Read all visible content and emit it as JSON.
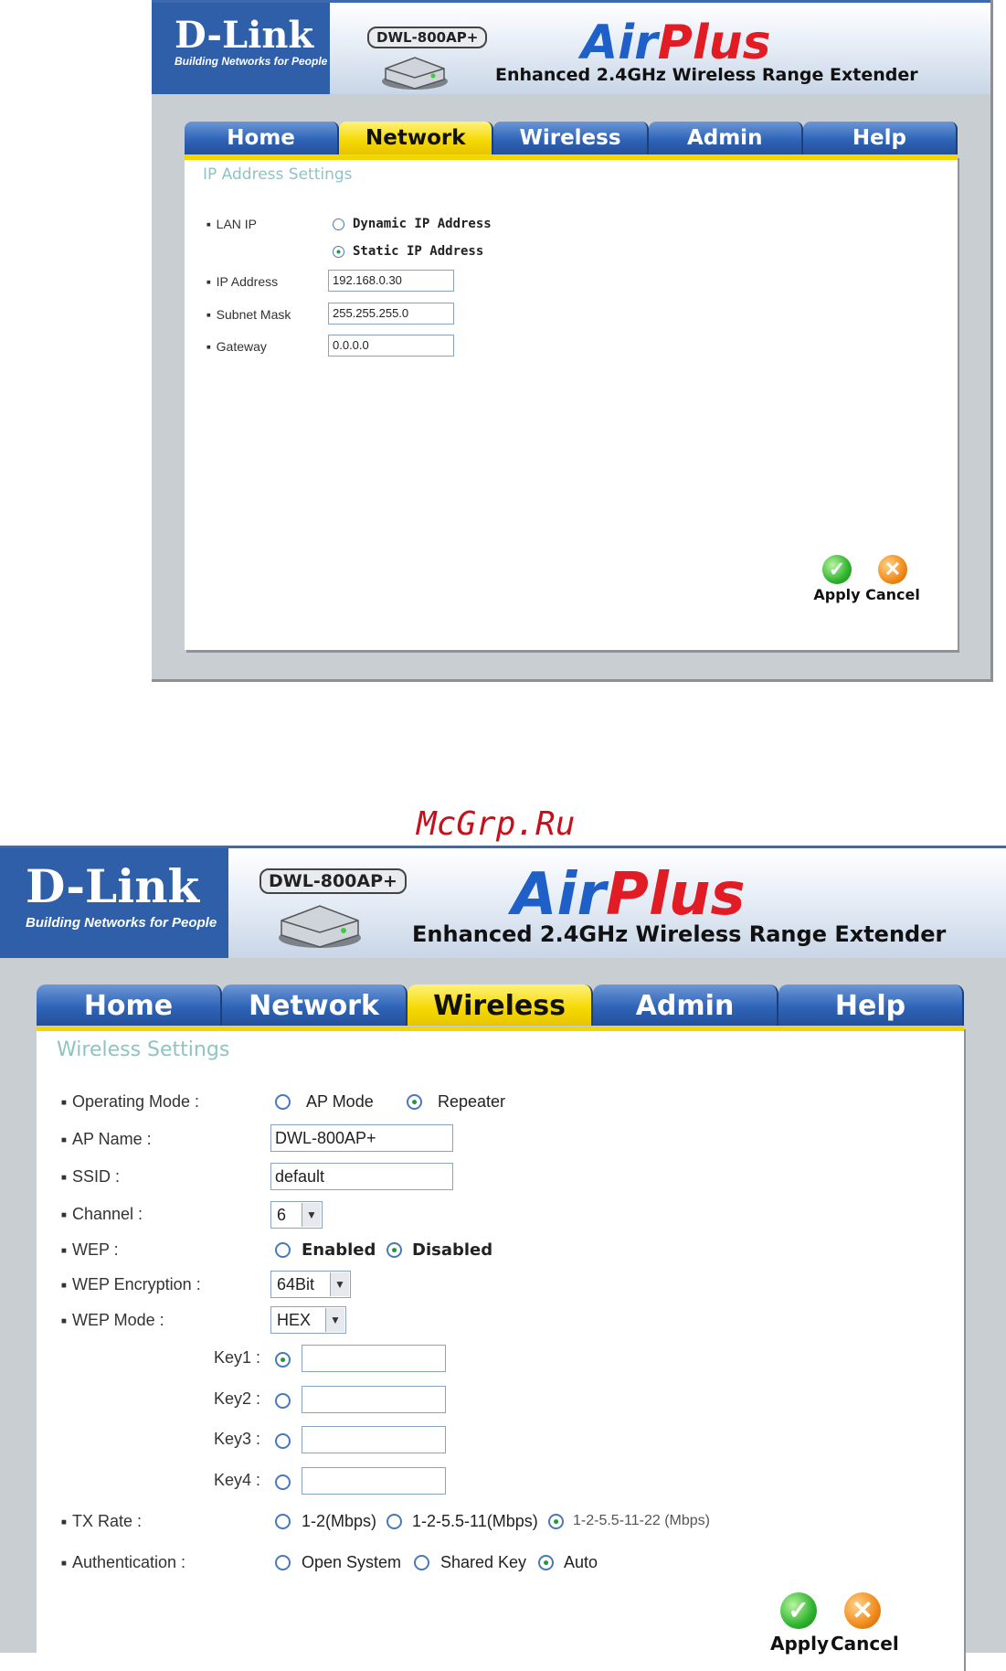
{
  "watermark": "McGrp.Ru",
  "colors": {
    "header_blue": "#2f5fa9",
    "tab_blue": "#2f64b8",
    "tab_active_yellow": "#f5d800",
    "section_title": "#8fc3c3",
    "radio_selected": "#1d9b3d",
    "air": "#1f5fc8",
    "plus": "#e21c24"
  },
  "screen1": {
    "logo": {
      "name": "D-Link",
      "tagline": "Building Networks for People"
    },
    "model": "DWL-800AP+",
    "brand": {
      "air": "Air",
      "plus": "Plus"
    },
    "subtitle": "Enhanced 2.4GHz Wireless Range Extender",
    "tabs": [
      "Home",
      "Network",
      "Wireless",
      "Admin",
      "Help"
    ],
    "active_tab": "Network",
    "section_title": "IP Address Settings",
    "lan_ip": {
      "label": "LAN IP",
      "options": [
        {
          "label": "Dynamic IP Address",
          "selected": false
        },
        {
          "label": "Static IP Address",
          "selected": true
        }
      ]
    },
    "ip_address": {
      "label": "IP Address",
      "value": "192.168.0.30"
    },
    "subnet_mask": {
      "label": "Subnet Mask",
      "value": "255.255.255.0"
    },
    "gateway": {
      "label": "Gateway",
      "value": "0.0.0.0"
    },
    "apply": "Apply",
    "cancel": "Cancel"
  },
  "screen2": {
    "logo": {
      "name": "D-Link",
      "tagline": "Building Networks for People"
    },
    "model": "DWL-800AP+",
    "brand": {
      "air": "Air",
      "plus": "Plus"
    },
    "subtitle": "Enhanced 2.4GHz Wireless Range Extender",
    "tabs": [
      "Home",
      "Network",
      "Wireless",
      "Admin",
      "Help"
    ],
    "active_tab": "Wireless",
    "section_title": "Wireless Settings",
    "operating_mode": {
      "label": "Operating Mode :",
      "options": [
        {
          "label": "AP Mode",
          "selected": false
        },
        {
          "label": "Repeater",
          "selected": true
        }
      ]
    },
    "ap_name": {
      "label": "AP Name :",
      "value": "DWL-800AP+"
    },
    "ssid": {
      "label": "SSID :",
      "value": "default"
    },
    "channel": {
      "label": "Channel :",
      "value": "6"
    },
    "wep": {
      "label": "WEP :",
      "options": [
        {
          "label": "Enabled",
          "selected": false
        },
        {
          "label": "Disabled",
          "selected": true
        }
      ]
    },
    "wep_encryption": {
      "label": "WEP Encryption :",
      "value": "64Bit"
    },
    "wep_mode": {
      "label": "WEP Mode :",
      "value": "HEX"
    },
    "keys": [
      {
        "label": "Key1 :",
        "selected": true,
        "value": ""
      },
      {
        "label": "Key2 :",
        "selected": false,
        "value": ""
      },
      {
        "label": "Key3 :",
        "selected": false,
        "value": ""
      },
      {
        "label": "Key4 :",
        "selected": false,
        "value": ""
      }
    ],
    "tx_rate": {
      "label": "TX Rate :",
      "options": [
        {
          "label": "1-2(Mbps)",
          "selected": false
        },
        {
          "label": "1-2-5.5-11(Mbps)",
          "selected": false
        },
        {
          "label": "1-2-5.5-11-22 (Mbps)",
          "selected": true
        }
      ]
    },
    "authentication": {
      "label": "Authentication :",
      "options": [
        {
          "label": "Open System",
          "selected": false
        },
        {
          "label": "Shared Key",
          "selected": false
        },
        {
          "label": "Auto",
          "selected": true
        }
      ]
    },
    "apply": "Apply",
    "cancel": "Cancel"
  }
}
